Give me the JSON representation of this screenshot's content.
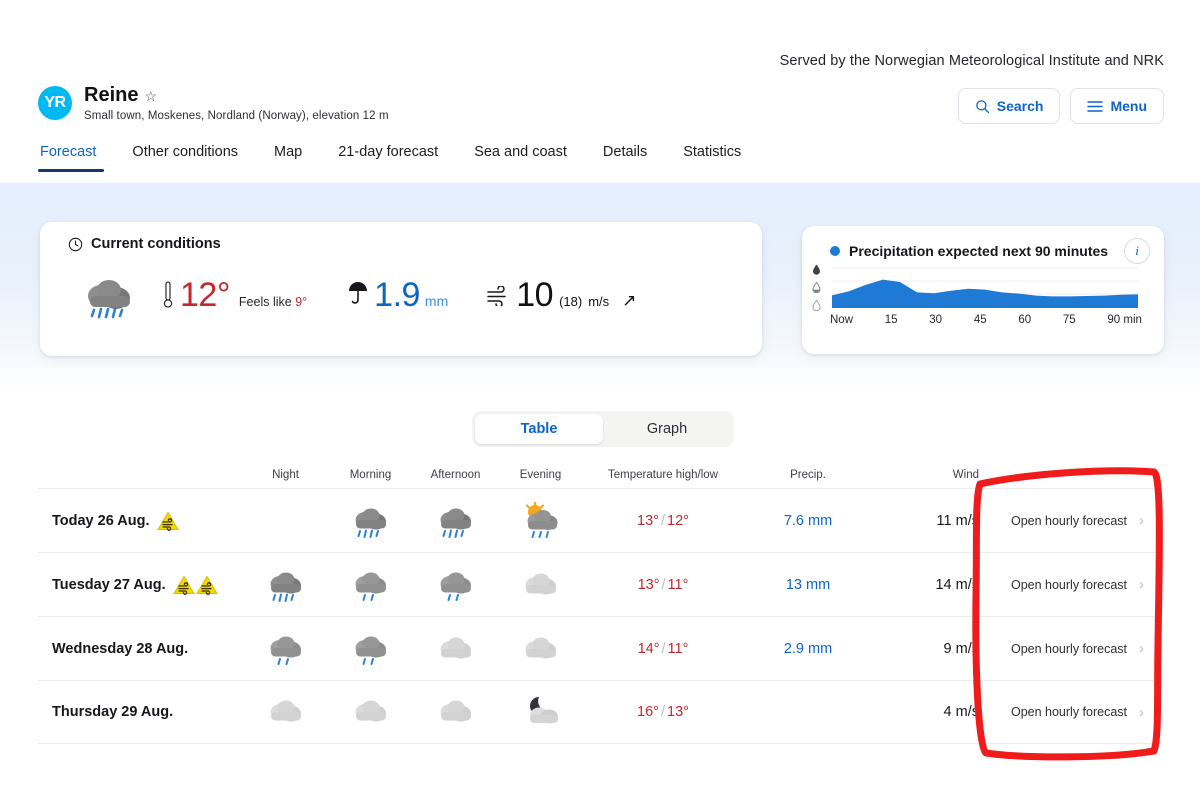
{
  "served_by": "Served by the Norwegian Meteorological Institute and NRK",
  "location": {
    "logo_text": "YR",
    "name": "Reine",
    "favorite_icon": "star-outline-icon",
    "subtitle": "Small town, Moskenes, Nordland (Norway), elevation 12 m"
  },
  "header_buttons": {
    "search_label": "Search",
    "menu_label": "Menu"
  },
  "tabs": [
    {
      "label": "Forecast",
      "active": true
    },
    {
      "label": "Other conditions",
      "active": false
    },
    {
      "label": "Map",
      "active": false
    },
    {
      "label": "21-day forecast",
      "active": false
    },
    {
      "label": "Sea and coast",
      "active": false
    },
    {
      "label": "Details",
      "active": false
    },
    {
      "label": "Statistics",
      "active": false
    }
  ],
  "current_conditions": {
    "title": "Current conditions",
    "clock_icon": "clock-icon",
    "weather_icon": "heavy-rain-cloud-icon",
    "thermometer_icon": "thermometer-icon",
    "temperature": "12°",
    "feels_like_prefix": "Feels like",
    "feels_like": "9°",
    "umbrella_icon": "umbrella-icon",
    "precipitation": "1.9",
    "precipitation_unit": "mm",
    "wind_icon": "wind-icon",
    "wind_speed": "10",
    "wind_gust": "(18)",
    "wind_unit": "m/s",
    "wind_direction_icon": "arrow-northeast-icon"
  },
  "precipitation_panel": {
    "title": "Precipitation expected next 90 minutes",
    "dot_icon": "blue-dot-icon",
    "info_icon": "info-icon",
    "info_label": "i"
  },
  "forecast_toggle": {
    "table_label": "Table",
    "graph_label": "Graph",
    "active": "Table"
  },
  "forecast_table": {
    "headers": {
      "day": "",
      "night": "Night",
      "morning": "Morning",
      "afternoon": "Afternoon",
      "evening": "Evening",
      "temperature": "Temperature high/low",
      "precipitation": "Precip.",
      "wind": "Wind",
      "link": ""
    },
    "rows": [
      {
        "day": "Today 26 Aug.",
        "warnings": [
          "wind-warning-icon"
        ],
        "night": "",
        "morning": "heavy-rain-cloud-icon",
        "afternoon": "heavy-rain-cloud-icon",
        "evening": "sun-cloud-rain-icon",
        "temp_high": "13°",
        "temp_low": "12°",
        "precip": "7.6 mm",
        "wind": "11 m/s",
        "link": "Open hourly forecast"
      },
      {
        "day": "Tuesday 27 Aug.",
        "warnings": [
          "wind-warning-icon",
          "wind-warning-icon"
        ],
        "night": "heavy-rain-cloud-icon",
        "morning": "rain-cloud-icon",
        "afternoon": "rain-cloud-icon",
        "evening": "cloud-icon",
        "temp_high": "13°",
        "temp_low": "11°",
        "precip": "13 mm",
        "wind": "14 m/s",
        "link": "Open hourly forecast"
      },
      {
        "day": "Wednesday 28 Aug.",
        "warnings": [],
        "night": "rain-cloud-icon",
        "morning": "rain-cloud-icon",
        "afternoon": "cloud-icon",
        "evening": "cloud-icon",
        "temp_high": "14°",
        "temp_low": "11°",
        "precip": "2.9 mm",
        "wind": "9 m/s",
        "link": "Open hourly forecast"
      },
      {
        "day": "Thursday 29 Aug.",
        "warnings": [],
        "night": "cloud-icon",
        "morning": "cloud-icon",
        "afternoon": "cloud-icon",
        "evening": "moon-cloud-icon",
        "temp_high": "16°",
        "temp_low": "13°",
        "precip": "",
        "wind": "4 m/s",
        "link": "Open hourly forecast"
      }
    ]
  },
  "annotation": {
    "shape": "hand-drawn-rectangle",
    "color": "#f01b1b",
    "target": "open-hourly-forecast-column"
  },
  "colors": {
    "brand_cyan": "#00b9f2",
    "link_blue": "#0d64c8",
    "temp_red": "#c3272b",
    "precip_blue": "#0d64c8",
    "chart_blue": "#1e7ad4",
    "band_blue": "#e4eefc",
    "annotation_red": "#f01b1b"
  },
  "chart_data": {
    "type": "area",
    "title": "Precipitation expected next 90 minutes",
    "x": [
      0,
      5,
      10,
      15,
      20,
      25,
      30,
      35,
      40,
      45,
      50,
      55,
      60,
      65,
      70,
      75,
      80,
      85,
      90
    ],
    "values": [
      0.3,
      0.4,
      0.58,
      0.72,
      0.66,
      0.42,
      0.4,
      0.46,
      0.5,
      0.48,
      0.42,
      0.38,
      0.33,
      0.3,
      0.3,
      0.31,
      0.33,
      0.35,
      0.36
    ],
    "tick_labels": [
      "Now",
      "15",
      "30",
      "45",
      "60",
      "75",
      "90 min"
    ],
    "xlabel": "",
    "ylabel": "",
    "ylim": [
      0,
      1
    ],
    "y_axis_icons": [
      "heavy-droplet-icon",
      "moderate-droplet-icon",
      "light-droplet-icon"
    ],
    "grid": true,
    "legend": "none",
    "fill_color": "#1e7ad4"
  }
}
